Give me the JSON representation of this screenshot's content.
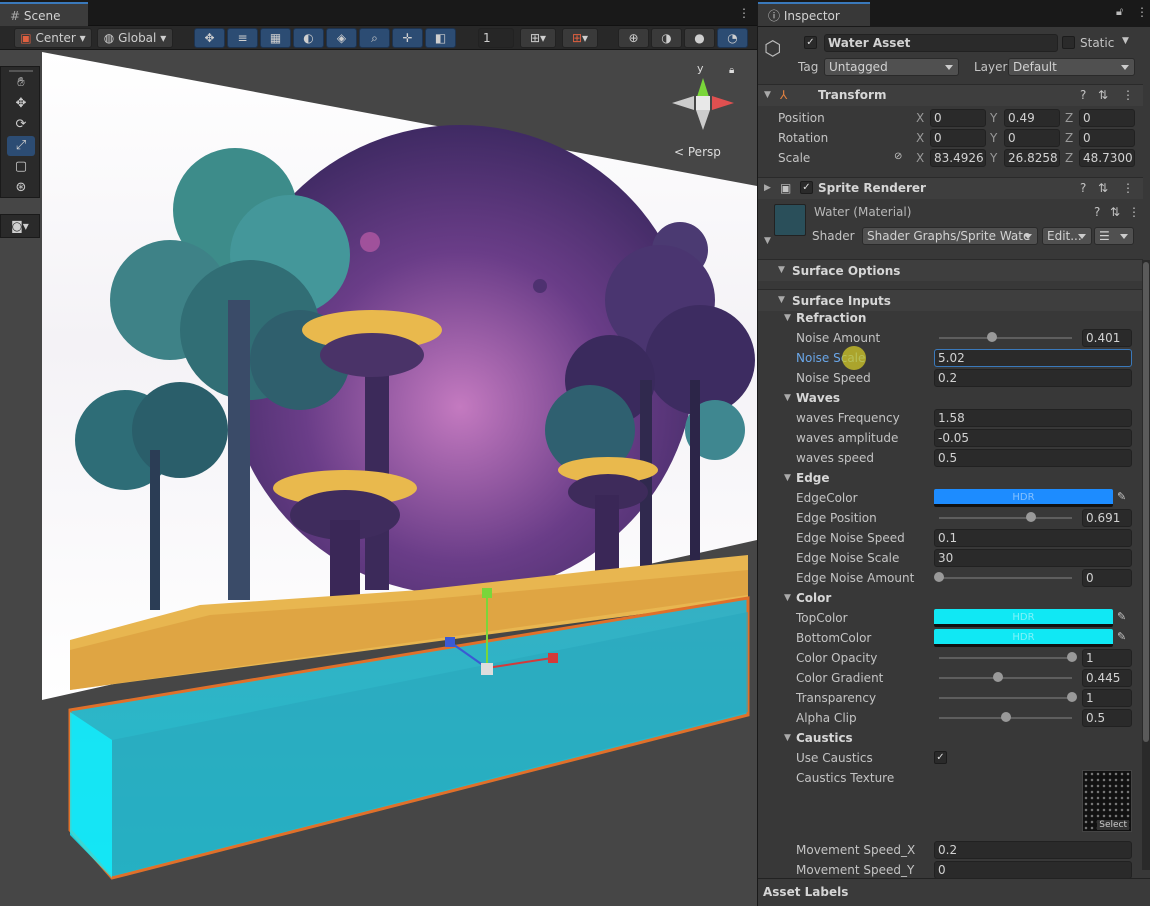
{
  "scene": {
    "tab_label": "Scene",
    "toolbar": {
      "pivot": "Center",
      "space": "Global",
      "grid_value": "1"
    },
    "gizmo": {
      "y_label": "y",
      "persp_label": "Persp"
    }
  },
  "inspector": {
    "tab_label": "Inspector",
    "object": {
      "name": "Water Asset",
      "static_label": "Static",
      "tag_label": "Tag",
      "tag_value": "Untagged",
      "layer_label": "Layer",
      "layer_value": "Default"
    },
    "transform": {
      "title": "Transform",
      "position": {
        "label": "Position",
        "x": "0",
        "y": "0.49",
        "z": "0"
      },
      "rotation": {
        "label": "Rotation",
        "x": "0",
        "y": "0",
        "z": "0"
      },
      "scale": {
        "label": "Scale",
        "x": "83.4926",
        "y": "26.8258",
        "z": "48.7300"
      }
    },
    "sprite_renderer": {
      "title": "Sprite Renderer"
    },
    "material": {
      "name": "Water (Material)",
      "shader_label": "Shader",
      "shader_value": "Shader Graphs/Sprite Wate",
      "edit_label": "Edit..."
    },
    "surface_options": "Surface Options",
    "surface_inputs": "Surface Inputs",
    "refraction": {
      "title": "Refraction",
      "noise_amount": {
        "label": "Noise Amount",
        "value": "0.401",
        "fraction": 0.4
      },
      "noise_scale": {
        "label": "Noise Scale",
        "value": "5.02"
      },
      "noise_speed": {
        "label": "Noise Speed",
        "value": "0.2"
      }
    },
    "waves": {
      "title": "Waves",
      "frequency": {
        "label": "waves Frequency",
        "value": "1.58"
      },
      "amplitude": {
        "label": "waves amplitude",
        "value": "-0.05"
      },
      "speed": {
        "label": "waves speed",
        "value": "0.5"
      }
    },
    "edge": {
      "title": "Edge",
      "color": {
        "label": "EdgeColor",
        "hdr": "HDR"
      },
      "position": {
        "label": "Edge Position",
        "value": "0.691",
        "fraction": 0.691
      },
      "noise_speed": {
        "label": "Edge Noise Speed",
        "value": "0.1"
      },
      "noise_scale": {
        "label": "Edge Noise Scale",
        "value": "30"
      },
      "noise_amount": {
        "label": "Edge Noise Amount",
        "value": "0",
        "fraction": 0
      }
    },
    "color": {
      "title": "Color",
      "top": {
        "label": "TopColor",
        "hdr": "HDR"
      },
      "bottom": {
        "label": "BottomColor",
        "hdr": "HDR"
      },
      "opacity": {
        "label": "Color Opacity",
        "value": "1",
        "fraction": 1
      },
      "gradient": {
        "label": "Color Gradient",
        "value": "0.445",
        "fraction": 0.445
      },
      "transparency": {
        "label": "Transparency",
        "value": "1",
        "fraction": 1
      },
      "alpha_clip": {
        "label": "Alpha Clip",
        "value": "0.5",
        "fraction": 0.5
      }
    },
    "caustics": {
      "title": "Caustics",
      "use": {
        "label": "Use Caustics"
      },
      "texture": {
        "label": "Caustics Texture",
        "select": "Select"
      },
      "speed_x": {
        "label": "Movement Speed_X",
        "value": "0.2"
      },
      "speed_y": {
        "label": "Movement Speed_Y",
        "value": "0"
      }
    },
    "asset_labels": "Asset Labels"
  },
  "colors": {
    "edge": "#1d8cff",
    "top": "#10e8f4",
    "bottom": "#10e8f4",
    "accent": "#3a79bb"
  }
}
